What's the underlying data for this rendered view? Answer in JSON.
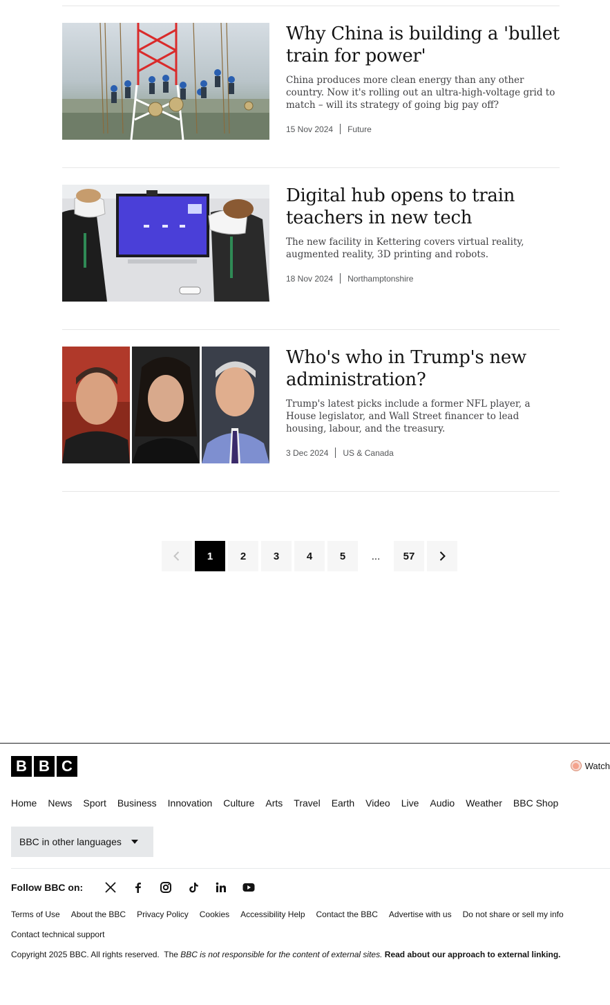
{
  "articles": [
    {
      "headline": "Why China is building a 'bullet train for power'",
      "summary": "China produces more clean energy than any other country. Now it's rolling out an ultra-high-voltage grid to match – will its strategy of going big pay off?",
      "date": "15 Nov 2024",
      "section": "Future",
      "image": "workers-on-power-pylon"
    },
    {
      "headline": "Digital hub opens to train teachers in new tech",
      "summary": "The new facility in Kettering covers virtual reality, augmented reality, 3D printing and robots.",
      "date": "18 Nov 2024",
      "section": "Northamptonshire",
      "image": "vr-headsets-classroom"
    },
    {
      "headline": "Who's who in Trump's new administration?",
      "summary": "Trump's latest picks include a former NFL player, a House legislator, and Wall Street financer to lead housing, labour, and the treasury.",
      "date": "3 Dec 2024",
      "section": "US & Canada",
      "image": "three-portraits"
    }
  ],
  "pagination": {
    "pages": [
      "1",
      "2",
      "3",
      "4",
      "5"
    ],
    "ellipsis": "...",
    "last": "57",
    "current": "1"
  },
  "footer": {
    "logo": [
      "B",
      "B",
      "C"
    ],
    "watch_label": "Watch",
    "nav": [
      "Home",
      "News",
      "Sport",
      "Business",
      "Innovation",
      "Culture",
      "Arts",
      "Travel",
      "Earth",
      "Video",
      "Live",
      "Audio",
      "Weather",
      "BBC Shop"
    ],
    "languages_label": "BBC in other languages",
    "follow_label": "Follow BBC on:",
    "social": [
      "x-icon",
      "facebook-icon",
      "instagram-icon",
      "tiktok-icon",
      "linkedin-icon",
      "youtube-icon"
    ],
    "links": [
      "Terms of Use",
      "About the BBC",
      "Privacy Policy",
      "Cookies",
      "Accessibility Help",
      "Contact the BBC",
      "Advertise with us",
      "Do not share or sell my info",
      "Contact technical support"
    ],
    "copyright_text": "Copyright 2025 BBC. All rights reserved.",
    "the_text": "The",
    "bbc_italic": "BBC",
    "responsibility_text": "is not responsible for the content of external sites.",
    "external_linking_text": "Read about our approach to external linking."
  },
  "colors": {
    "active_page": "#000000",
    "page_bg": "#f6f6f6",
    "language_button_bg": "#e6e8ea",
    "watch_dot": "#f4a38d"
  }
}
